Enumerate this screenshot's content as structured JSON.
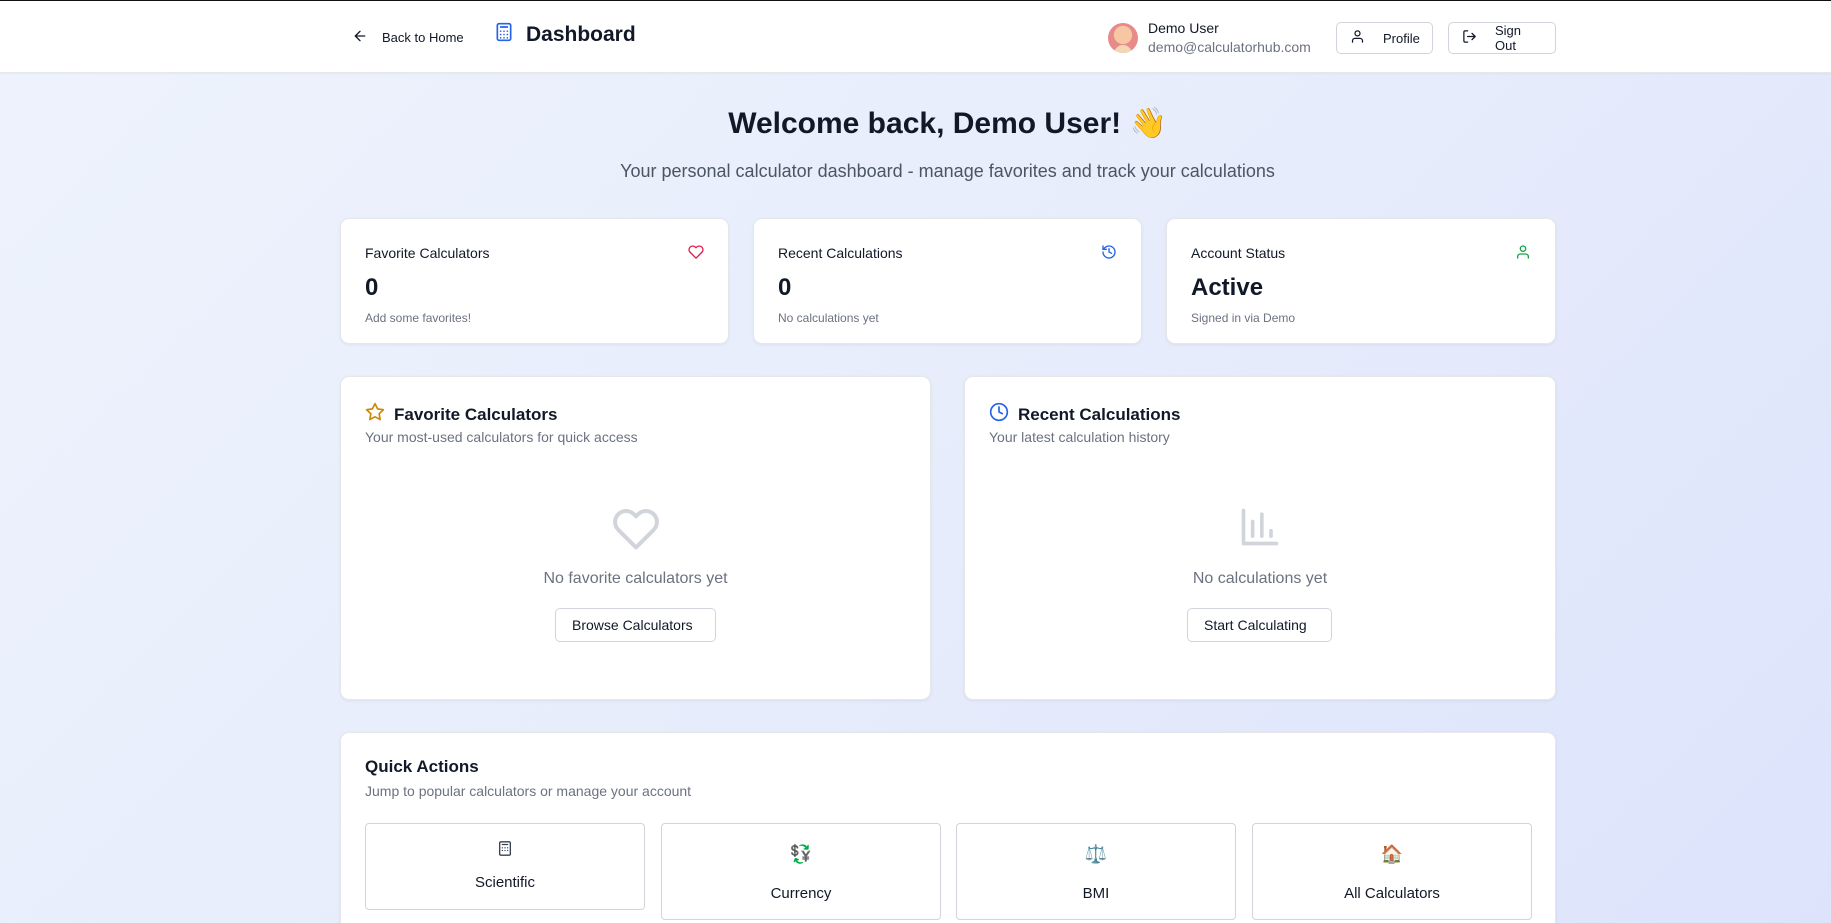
{
  "header": {
    "back_label": "Back to Home",
    "title": "Dashboard",
    "user_name": "Demo User",
    "user_email": "demo@calculatorhub.com",
    "profile_label": "Profile",
    "signout_label": "Sign Out"
  },
  "hero": {
    "title": "Welcome back, Demo User! 👋",
    "subtitle": "Your personal calculator dashboard - manage favorites and track your calculations"
  },
  "stats": [
    {
      "label": "Favorite Calculators",
      "value": "0",
      "note": "Add some favorites!",
      "icon": "heart-icon",
      "color": "#e11d48"
    },
    {
      "label": "Recent Calculations",
      "value": "0",
      "note": "No calculations yet",
      "icon": "history-icon",
      "color": "#2563eb"
    },
    {
      "label": "Account Status",
      "value": "Active",
      "note": "Signed in via Demo",
      "icon": "user-icon",
      "color": "#16a34a"
    }
  ],
  "panels": {
    "favorites": {
      "title": "Favorite Calculators",
      "subtitle": "Your most-used calculators for quick access",
      "empty_text": "No favorite calculators yet",
      "button": "Browse Calculators",
      "icon": "star-icon",
      "color": "#ca8a04"
    },
    "recent": {
      "title": "Recent Calculations",
      "subtitle": "Your latest calculation history",
      "empty_text": "No calculations yet",
      "button": "Start Calculating",
      "icon": "clock-icon",
      "color": "#2563eb"
    }
  },
  "quick_actions": {
    "title": "Quick Actions",
    "subtitle": "Jump to popular calculators or manage your account",
    "tiles": [
      {
        "label": "Scientific",
        "icon": "calculator-icon",
        "glyph": ""
      },
      {
        "label": "Currency",
        "icon": "currency-icon",
        "glyph": "💱"
      },
      {
        "label": "BMI",
        "icon": "scale-icon",
        "glyph": "⚖️"
      },
      {
        "label": "All Calculators",
        "icon": "house-icon",
        "glyph": "🏠"
      }
    ]
  },
  "colors": {
    "text": "#111827",
    "muted": "#6b7280",
    "border": "#e5e7eb"
  }
}
